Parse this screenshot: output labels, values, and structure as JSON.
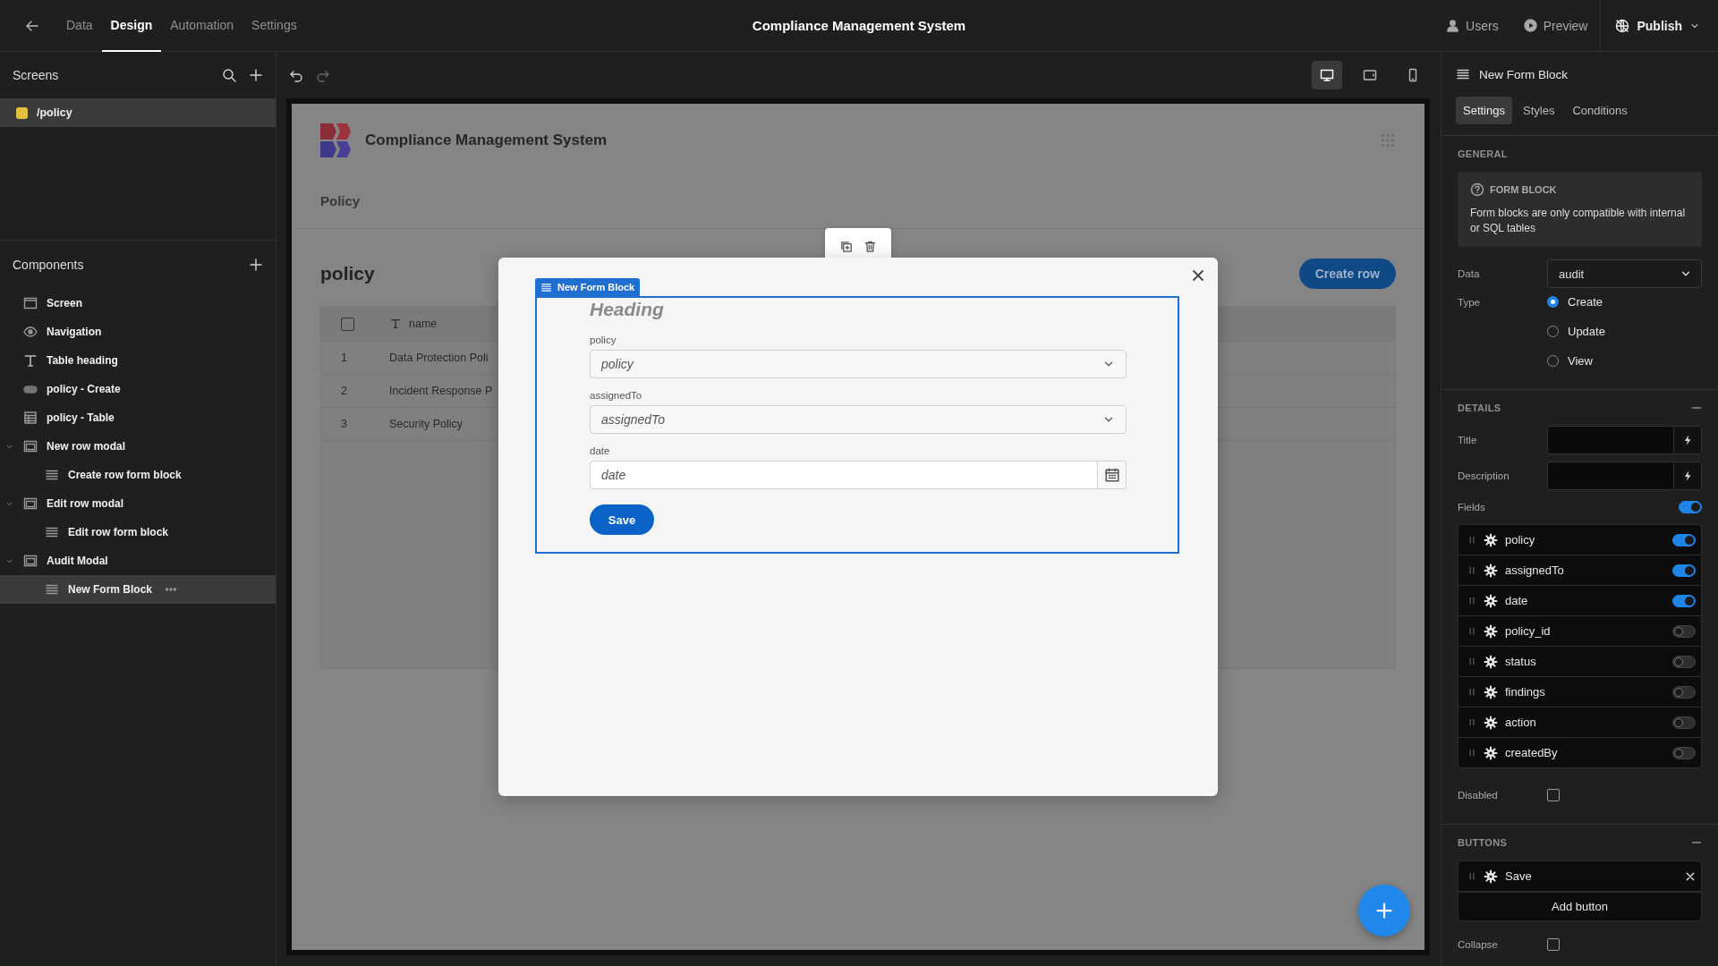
{
  "topbar": {
    "tabs": [
      {
        "label": "Data",
        "selected": false
      },
      {
        "label": "Design",
        "selected": true
      },
      {
        "label": "Automation",
        "selected": false
      },
      {
        "label": "Settings",
        "selected": false
      }
    ],
    "title": "Compliance Management System",
    "actions": [
      {
        "label": "Users",
        "kind": "users"
      },
      {
        "label": "Preview",
        "kind": "preview"
      }
    ],
    "publish": "Publish"
  },
  "screens": {
    "title": "Screens",
    "items": [
      {
        "label": "/policy",
        "selected": true,
        "color": "#e5c03a"
      }
    ]
  },
  "components": {
    "title": "Components",
    "items": [
      {
        "label": "Screen",
        "kind": "screen",
        "selected": false
      },
      {
        "label": "Navigation",
        "kind": "navigation",
        "selected": false
      },
      {
        "label": "Table heading",
        "kind": "heading",
        "selected": false
      },
      {
        "label": "policy - Create",
        "kind": "button",
        "selected": false
      },
      {
        "label": "policy - Table",
        "kind": "table",
        "selected": false
      },
      {
        "label": "New row modal",
        "kind": "modal",
        "selected": false,
        "expanded": true,
        "children": [
          {
            "label": "Create row form block",
            "kind": "form",
            "selected": false
          }
        ]
      },
      {
        "label": "Edit row modal",
        "kind": "modal",
        "selected": false,
        "expanded": true,
        "children": [
          {
            "label": "Edit row form block",
            "kind": "form",
            "selected": false
          }
        ]
      },
      {
        "label": "Audit Modal",
        "kind": "modal",
        "selected": false,
        "expanded": true,
        "children": [
          {
            "label": "New Form Block",
            "kind": "form",
            "selected": true
          }
        ]
      }
    ]
  },
  "toolbar": {
    "devices": [
      {
        "kind": "desktop",
        "selected": true
      },
      {
        "kind": "tablet",
        "selected": false
      },
      {
        "kind": "mobile",
        "selected": false
      }
    ]
  },
  "preview": {
    "app_title": "Compliance Management System",
    "nav": [
      "Policy"
    ],
    "heading": "policy",
    "create_button": "Create row",
    "table": {
      "select_all": false,
      "columns": [
        "name"
      ],
      "rows": [
        {
          "index": "1",
          "name": "Data Protection Poli"
        },
        {
          "index": "2",
          "name": "Incident Response P"
        },
        {
          "index": "3",
          "name": "Security Policy"
        }
      ]
    },
    "modal": {
      "block_label": "New Form Block",
      "heading": "Heading",
      "fields": [
        {
          "label": "policy",
          "placeholder": "policy",
          "kind": "select"
        },
        {
          "label": "assignedTo",
          "placeholder": "assignedTo",
          "kind": "select"
        },
        {
          "label": "date",
          "placeholder": "date",
          "kind": "date"
        }
      ],
      "submit": "Save"
    }
  },
  "panel": {
    "title": "New Form Block",
    "tabs": [
      {
        "label": "Settings",
        "selected": true
      },
      {
        "label": "Styles",
        "selected": false
      },
      {
        "label": "Conditions",
        "selected": false
      }
    ],
    "general": {
      "heading": "GENERAL",
      "info_title": "FORM BLOCK",
      "info_text": "Form blocks are only compatible with internal or SQL tables",
      "data_label": "Data",
      "data_value": "audit",
      "type_label": "Type",
      "types": [
        {
          "label": "Create",
          "selected": true
        },
        {
          "label": "Update",
          "selected": false
        },
        {
          "label": "View",
          "selected": false
        }
      ]
    },
    "details": {
      "heading": "DETAILS",
      "title_label": "Title",
      "description_label": "Description",
      "fields_label": "Fields",
      "fields_on": true,
      "fields": [
        {
          "name": "policy",
          "on": true
        },
        {
          "name": "assignedTo",
          "on": true
        },
        {
          "name": "date",
          "on": true
        },
        {
          "name": "policy_id",
          "on": false
        },
        {
          "name": "status",
          "on": false
        },
        {
          "name": "findings",
          "on": false
        },
        {
          "name": "action",
          "on": false
        },
        {
          "name": "createdBy",
          "on": false
        }
      ],
      "disabled_label": "Disabled",
      "disabled": false
    },
    "buttons": {
      "heading": "BUTTONS",
      "items": [
        "Save"
      ],
      "add": "Add button",
      "collapse_label": "Collapse",
      "collapse": false
    }
  }
}
